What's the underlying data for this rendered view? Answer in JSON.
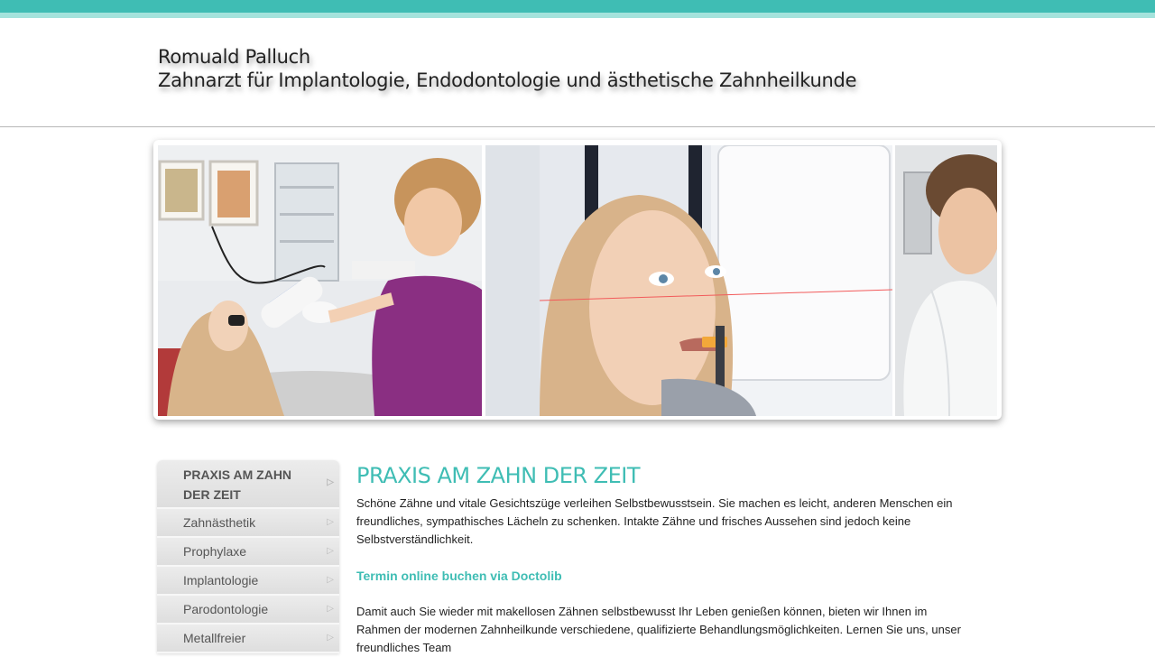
{
  "header": {
    "name": "Romuald Palluch",
    "subtitle": "Zahnarzt für Implantologie, Endodontologie und ästhetische Zahnheilkunde"
  },
  "colors": {
    "accent": "#3fbdb4",
    "accent_light": "#a4e3dc"
  },
  "sidebar": {
    "items": [
      {
        "label": "PRAXIS AM ZAHN DER ZEIT",
        "active": true
      },
      {
        "label": "Zahnästhetik"
      },
      {
        "label": "Prophylaxe"
      },
      {
        "label": "Implantologie"
      },
      {
        "label": "Parodontologie"
      },
      {
        "label": "Metallfreier Zahnersatz"
      }
    ],
    "arrow_icon": "triangle-right-icon"
  },
  "main": {
    "title": "PRAXIS AM ZAHN DER ZEIT",
    "intro": "Schöne Zähne und vitale Gesichtszüge verleihen Selbstbewusstsein. Sie machen es leicht, anderen Menschen ein freundliches, sympathisches Lächeln zu schenken. Intakte Zähne und frisches Aussehen sind jedoch keine Selbstverständlichkeit.",
    "booking_link": "Termin online buchen via Doctolib",
    "body": "Damit auch Sie wieder mit makellosen Zähnen selbstbewusst Ihr Leben genießen können, bieten wir Ihnen im Rahmen der modernen Zahnheilkunde verschiedene, qualifizierte Behandlungsmöglichkeiten. Lernen Sie uns, unser freundliches Team"
  }
}
